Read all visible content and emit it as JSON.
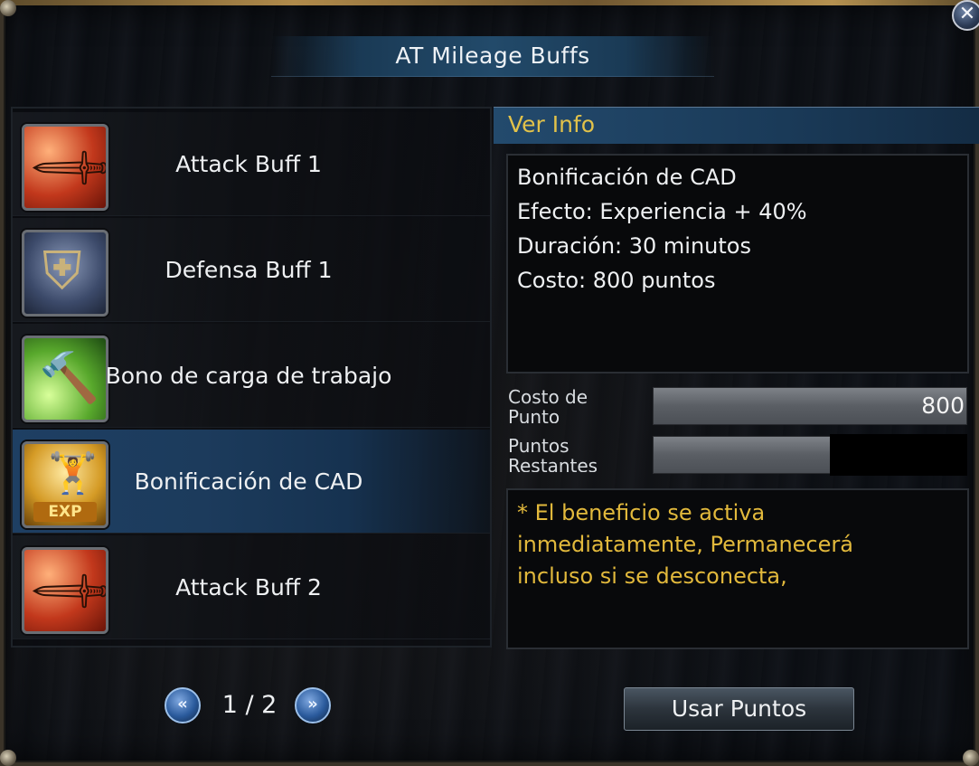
{
  "window": {
    "title": "AT Mileage Buffs",
    "close_label": "✕"
  },
  "list": {
    "items": [
      {
        "label": "Attack Buff 1",
        "icon": "sword-icon",
        "selected": false
      },
      {
        "label": "Defensa Buff 1",
        "icon": "shield-icon",
        "selected": false
      },
      {
        "label": "Bono de carga de trabajo",
        "icon": "hammer-icon",
        "selected": false
      },
      {
        "label": "Bonificación de CAD",
        "icon": "exp-icon",
        "selected": true
      },
      {
        "label": "Attack Buff 2",
        "icon": "sword-icon",
        "selected": false
      }
    ]
  },
  "info": {
    "header": "Ver Info",
    "lines": [
      "Bonificación de CAD",
      "Efecto: Experiencia + 40%",
      "Duración: 30 minutos",
      "Costo: 800 puntos"
    ]
  },
  "stats": {
    "cost_label": "Costo de Punto",
    "cost_value": "800",
    "remaining_label": "Puntos Restantes",
    "remaining_value": ""
  },
  "note": {
    "lines": [
      "* El beneficio se activa",
      "inmediatamente, Permanecerá",
      "incluso si se desconecta,"
    ]
  },
  "pager": {
    "text": "1 / 2",
    "prev_glyph": "«",
    "next_glyph": "»"
  },
  "actions": {
    "use_label": "Usar Puntos"
  },
  "colors": {
    "accent_gold": "#e2c24a",
    "selected_row": "#1e3f63",
    "header_blue": "#234a6d"
  }
}
